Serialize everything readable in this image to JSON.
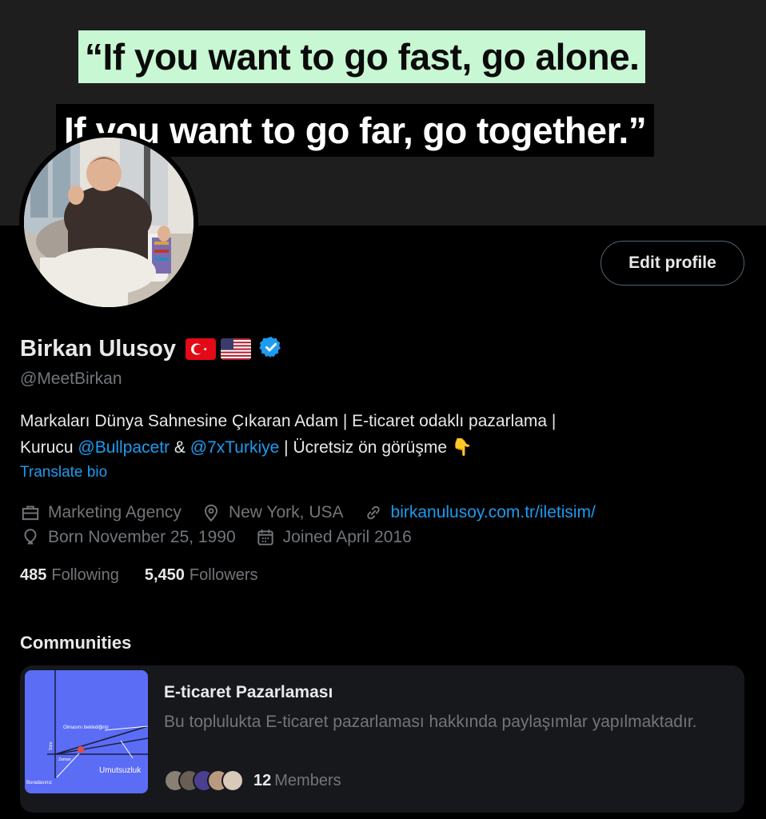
{
  "banner": {
    "line1": "“If you want to go fast, go alone.",
    "line2": "If you want to go far, go together.”"
  },
  "profile": {
    "edit_label": "Edit profile",
    "name": "Birkan Ulusoy",
    "flags": [
      "turkey-flag-icon",
      "us-flag-icon"
    ],
    "handle": "@MeetBirkan",
    "bio_line1": "Markaları Dünya Sahnesine Çıkaran Adam | E-ticaret odaklı pazarlama |",
    "bio_kurucu": "Kurucu ",
    "bio_link1": "@Bullpacetr",
    "bio_and": " & ",
    "bio_link2": "@7xTurkiye",
    "bio_rest": " | Ücretsiz ön görüşme ",
    "bio_emoji": "👇",
    "translate": "Translate bio",
    "category": "Marketing Agency",
    "location": "New York, USA",
    "website": "birkanulusoy.com.tr/iletisim/",
    "born": "Born November 25, 1990",
    "joined": "Joined April 2016",
    "following_count": "485",
    "following_label": "Following",
    "followers_count": "5,450",
    "followers_label": "Followers"
  },
  "communities": {
    "title": "Communities",
    "card": {
      "name": "E-ticaret Pazarlaması",
      "description": "Bu toplulukta E-ticaret pazarlaması hakkında paylaşımlar yapılmaktadır.",
      "members_count": "12",
      "members_label": "Members",
      "image_text": {
        "expected": "Olmasını beklediğiniz",
        "umutsuzluk": "Umutsuzluk",
        "buradasiniz": "Buradasınız",
        "zaman": "Zaman",
        "sure": "Süre"
      }
    }
  },
  "colors": {
    "accent": "#1d9bf0",
    "muted": "#71767b",
    "text": "#e7e9ea",
    "quote_highlight": "#c8f7d3",
    "community_image_bg": "#5b6cf5"
  }
}
